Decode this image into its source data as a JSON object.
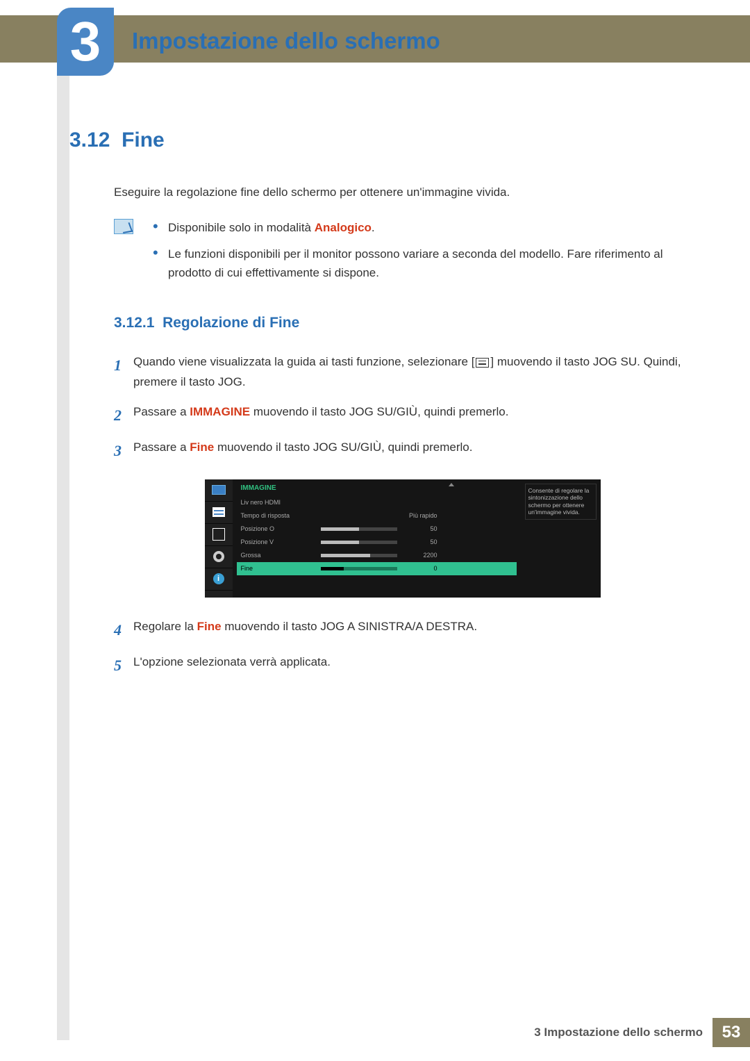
{
  "chapter": {
    "number": "3",
    "title": "Impostazione dello schermo"
  },
  "section": {
    "number": "3.12",
    "title": "Fine",
    "intro": "Eseguire la regolazione fine dello schermo per ottenere un'immagine vivida."
  },
  "notes": {
    "item1_prefix": "Disponibile solo in modalità ",
    "item1_highlight": "Analogico",
    "item1_suffix": ".",
    "item2": "Le funzioni disponibili per il monitor possono variare a seconda del modello. Fare riferimento al prodotto di cui effettivamente si dispone."
  },
  "subsection": {
    "number": "3.12.1",
    "title": "Regolazione di Fine"
  },
  "steps": {
    "s1a": "Quando viene visualizzata la guida ai tasti funzione, selezionare [",
    "s1b": "] muovendo il tasto JOG SU. Quindi, premere il tasto JOG.",
    "s2a": "Passare a ",
    "s2a_hl": "IMMAGINE",
    "s2b": " muovendo il tasto JOG SU/GIÙ, quindi premerlo.",
    "s3a": "Passare a ",
    "s3a_hl": "Fine",
    "s3b": " muovendo il tasto JOG SU/GIÙ, quindi premerlo.",
    "s4a": "Regolare la ",
    "s4a_hl": "Fine",
    "s4b": " muovendo il tasto JOG A SINISTRA/A DESTRA.",
    "s5": "L'opzione selezionata verrà applicata."
  },
  "osd": {
    "menu_title": "IMMAGINE",
    "desc": "Consente di regolare la sintonizzazione dello schermo per ottenere un'immagine vivida.",
    "rows": [
      {
        "label": "Liv nero HDMI",
        "value": "",
        "fill": 0,
        "bar": false
      },
      {
        "label": "Tempo di risposta",
        "value": "Più rapido",
        "fill": 0,
        "bar": false
      },
      {
        "label": "Posizione O",
        "value": "50",
        "fill": 50,
        "bar": true
      },
      {
        "label": "Posizione V",
        "value": "50",
        "fill": 50,
        "bar": true
      },
      {
        "label": "Grossa",
        "value": "2200",
        "fill": 65,
        "bar": true
      },
      {
        "label": "Fine",
        "value": "0",
        "fill": 30,
        "bar": true,
        "selected": true
      }
    ]
  },
  "footer": {
    "text": "3 Impostazione dello schermo",
    "page": "53"
  }
}
